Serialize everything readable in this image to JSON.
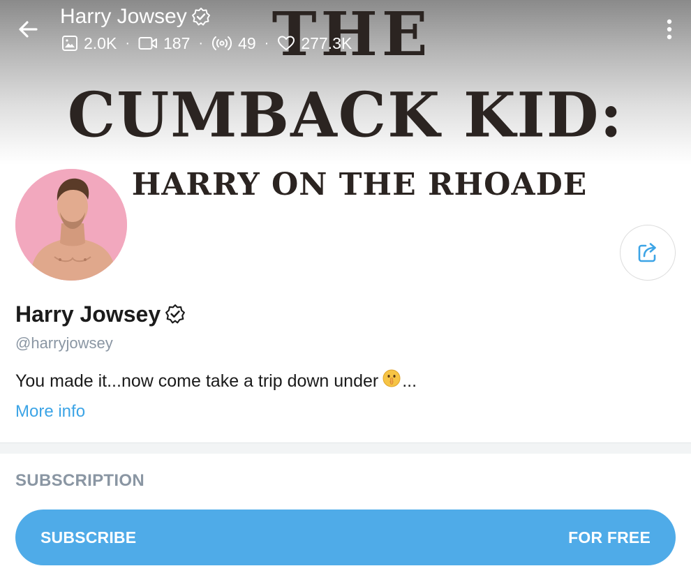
{
  "header": {
    "title": "Harry Jowsey",
    "stats": {
      "photos": "2.0K",
      "videos": "187",
      "streams": "49",
      "likes": "277.3K"
    }
  },
  "cover": {
    "line1": "THE",
    "line2": "CUMBACK KID:",
    "line3": "HARRY ON THE RHOADE"
  },
  "profile": {
    "name": "Harry Jowsey",
    "handle": "@harryjowsey",
    "bio": "You made it...now come take a trip down under",
    "bio_suffix": "...",
    "more_info_label": "More info"
  },
  "subscription": {
    "heading": "SUBSCRIPTION",
    "button_label": "SUBSCRIBE",
    "price_label": "FOR FREE"
  },
  "colors": {
    "accent": "#4fabe8",
    "link": "#3ca4e6",
    "muted": "#8a96a3"
  },
  "icons": [
    "back-arrow-icon",
    "verified-icon",
    "image-icon",
    "video-icon",
    "stream-icon",
    "heart-icon",
    "more-vertical-icon",
    "share-icon",
    "shushing-face-emoji"
  ]
}
